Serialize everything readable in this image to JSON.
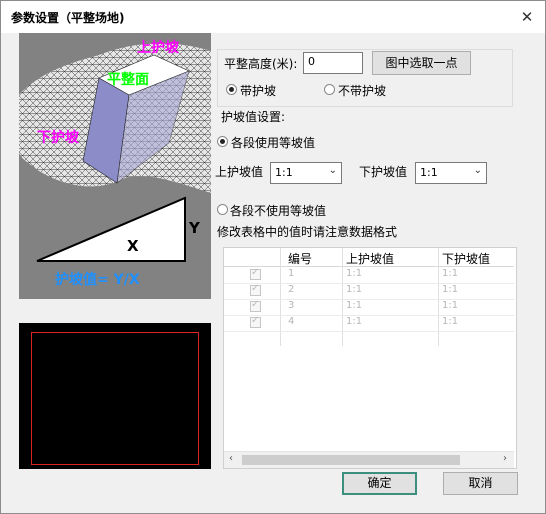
{
  "window": {
    "title": "参数设置（平整场地)",
    "close_icon": "close-icon"
  },
  "illustration": {
    "top_slope": "上护坡",
    "flat_surface": "平整面",
    "bottom_slope": "下护坡",
    "axis_x": "X",
    "axis_y": "Y",
    "formula": "护坡值= Y/X",
    "colors": {
      "top_slope": "#ff00ff",
      "flat_surface": "#00ff00",
      "bottom_slope": "#ff00ff",
      "formula": "#1e90ff"
    }
  },
  "level_height": {
    "label": "平整高度(米):",
    "value": "0"
  },
  "pick_button": {
    "label": "图中选取一点"
  },
  "slope_mode": {
    "with_slope": "带护坡",
    "without_slope": "不带护坡",
    "selected": "with_slope"
  },
  "slope_settings": {
    "label": "护坡值设置:"
  },
  "equal_slope": {
    "label": "各段使用等坡值",
    "selected": true,
    "top_label": "上护坡值",
    "top_value": "1:1",
    "bottom_label": "下护坡值",
    "bottom_value": "1:1"
  },
  "unequal_slope": {
    "label": "各段不使用等坡值",
    "selected": false,
    "hint": "修改表格中的值时请注意数据格式"
  },
  "table": {
    "headers": [
      "编号",
      "上护坡值",
      "下护坡值"
    ],
    "rows": [
      {
        "id": "1",
        "top": "1:1",
        "bottom": "1:1"
      },
      {
        "id": "2",
        "top": "1:1",
        "bottom": "1:1"
      },
      {
        "id": "3",
        "top": "1:1",
        "bottom": "1:1"
      },
      {
        "id": "4",
        "top": "1:1",
        "bottom": "1:1"
      }
    ]
  },
  "buttons": {
    "ok": "确定",
    "cancel": "取消"
  }
}
